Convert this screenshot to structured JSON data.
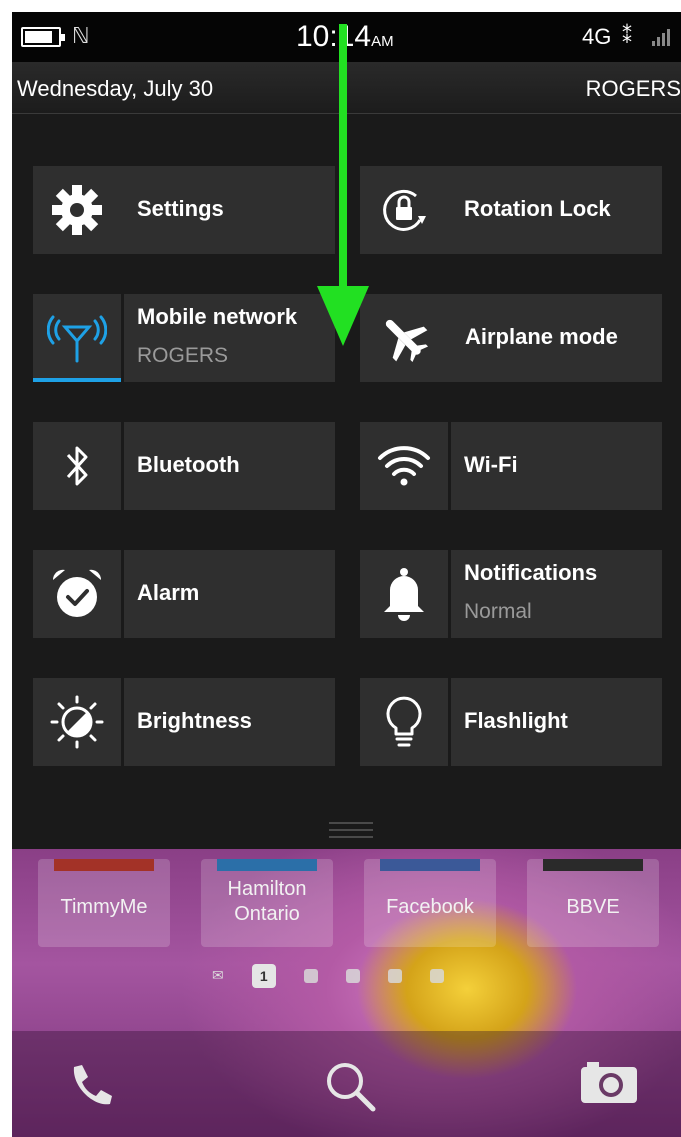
{
  "status_bar": {
    "time": "10:14",
    "ampm": "AM",
    "network_type": "4G",
    "battery_level": 0.85,
    "icons": [
      "battery-icon",
      "nfc-icon",
      "bbm-icon",
      "signal-icon"
    ]
  },
  "date_bar": {
    "date": "Wednesday, July 30",
    "carrier": "ROGERS"
  },
  "quick_settings": {
    "tiles": [
      {
        "label": "Settings",
        "icon": "gear-icon"
      },
      {
        "label": "Rotation Lock",
        "icon": "rotation-lock-icon"
      },
      {
        "label": "Mobile network",
        "sub": "ROGERS",
        "icon": "antenna-icon",
        "active": true
      },
      {
        "label": "Airplane mode",
        "icon": "airplane-icon"
      },
      {
        "label": "Bluetooth",
        "icon": "bluetooth-icon"
      },
      {
        "label": "Wi-Fi",
        "icon": "wifi-icon"
      },
      {
        "label": "Alarm",
        "icon": "alarm-icon"
      },
      {
        "label": "Notifications",
        "sub": "Normal",
        "icon": "bell-icon"
      },
      {
        "label": "Brightness",
        "icon": "brightness-icon"
      },
      {
        "label": "Flashlight",
        "icon": "lightbulb-icon"
      }
    ]
  },
  "home_screen": {
    "apps": [
      {
        "label": "TimmyMe"
      },
      {
        "label": "Hamilton Ontario"
      },
      {
        "label": "Facebook"
      },
      {
        "label": "BBVE"
      }
    ],
    "pager": {
      "current_page": "1"
    },
    "dock": [
      "phone-icon",
      "search-icon",
      "camera-icon"
    ]
  },
  "colors": {
    "accent": "#1ea1e6",
    "annotation_arrow": "#22e022",
    "tile_bg": "#2f2f2f"
  }
}
